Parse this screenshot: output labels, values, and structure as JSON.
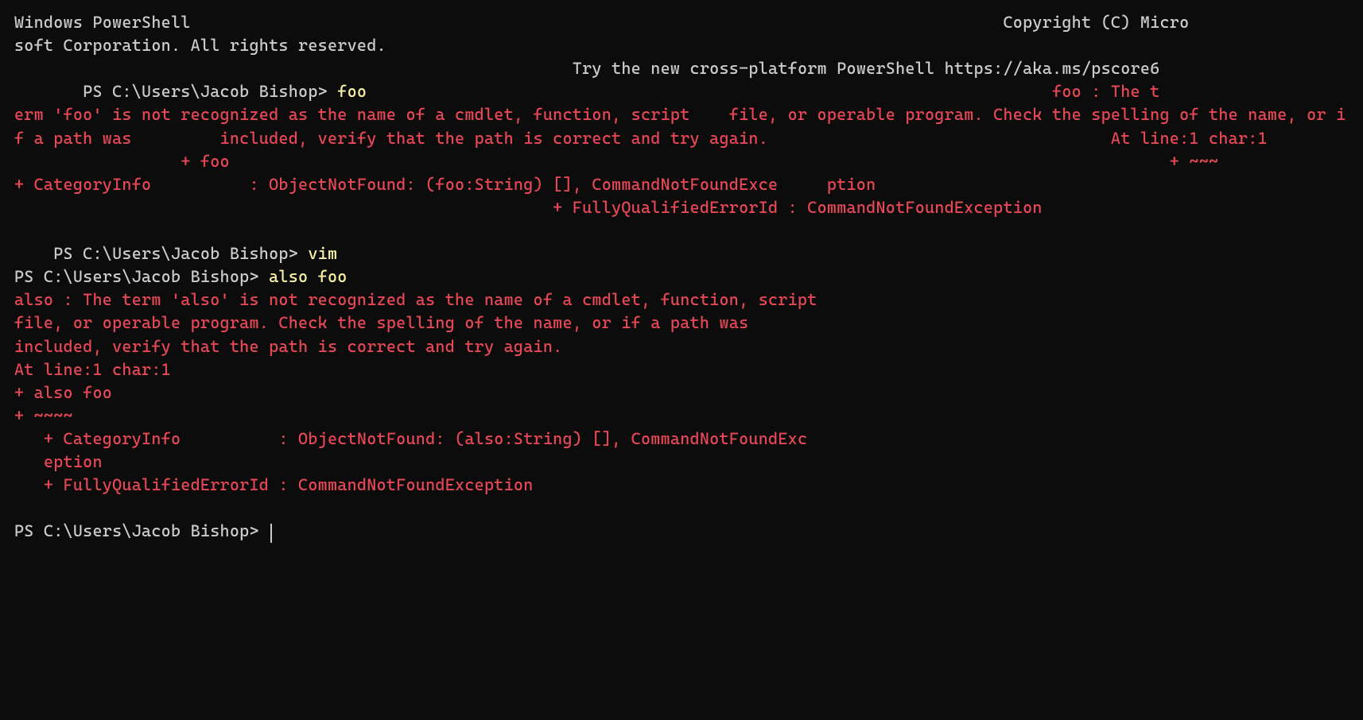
{
  "header_line1a": "Windows PowerShell",
  "header_pad1": "                                                                                   ",
  "header_line1b": "Copyright (C) Micro",
  "header_line2": "soft Corporation. All rights reserved.",
  "header_pad2": "                                                         ",
  "try_line": "Try the new cross-platform PowerShell https://aka.ms/pscore6",
  "indent1": "       ",
  "prompt1": "PS C:\\Users\\Jacob Bishop> ",
  "cmd1": "foo",
  "err_pad1": "                                                                      ",
  "err1_a": "foo : The t",
  "err1_b": "erm 'foo' is not recognized as the name of a cmdlet, function, script    file, or operable program. Check the spelling of the name, or if a path was         included, verify that the path is correct and try again.                                   At line:1 char:1",
  "err1_c": "                 + foo                                                                                                + ~~~                                                                                                    + CategoryInfo          : ObjectNotFound: (foo:String) [], CommandNotFoundExce     ption",
  "err1_d": "                                                       + FullyQualifiedErrorId : CommandNotFoundException",
  "indent2": "    ",
  "prompt2": "PS C:\\Users\\Jacob Bishop> ",
  "cmd2": "vim",
  "prompt3": "PS C:\\Users\\Jacob Bishop> ",
  "cmd3": "also foo",
  "err2_a": "also : The term 'also' is not recognized as the name of a cmdlet, function, script",
  "err2_b": "file, or operable program. Check the spelling of the name, or if a path was",
  "err2_c": "included, verify that the path is correct and try again.",
  "err2_d": "At line:1 char:1",
  "err2_e": "+ also foo",
  "err2_f": "+ ~~~~",
  "err2_g": "   + CategoryInfo          : ObjectNotFound: (also:String) [], CommandNotFoundExc",
  "err2_h": "   eption",
  "err2_i": "   + FullyQualifiedErrorId : CommandNotFoundException",
  "prompt4": "PS C:\\Users\\Jacob Bishop> "
}
